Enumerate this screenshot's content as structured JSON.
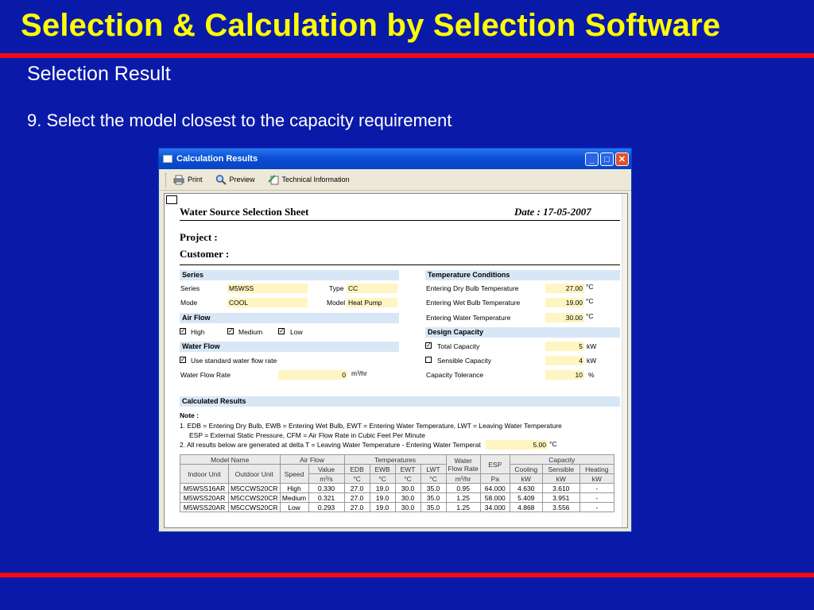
{
  "slide": {
    "title": "Selection & Calculation by Selection Software",
    "subtitle": "Selection Result",
    "step": "9. Select the model closest to the capacity requirement",
    "accent_red": "#F50A14",
    "title_yellow": "#FFFF00",
    "background": "#0A1AA8"
  },
  "window": {
    "title": "Calculation Results",
    "toolbar": {
      "print": "Print",
      "preview": "Preview",
      "tech_info": "Technical Information"
    },
    "controls": {
      "minimize": "_",
      "maximize": "□",
      "close": "✕"
    }
  },
  "sheet": {
    "title": "Water Source Selection Sheet",
    "date": "Date :  17-05-2007",
    "project_label": "Project :",
    "customer_label": "Customer :",
    "series": {
      "header": "Series",
      "series_label": "Series",
      "series_value": "M5WSS",
      "type_label": "Type",
      "type_value": "CC",
      "mode_label": "Mode",
      "mode_value": "COOL",
      "model_label": "Model",
      "model_value": "Heat Pump"
    },
    "air_flow": {
      "header": "Air Flow",
      "high": "High",
      "medium": "Medium",
      "low": "Low"
    },
    "water_flow": {
      "header": "Water Flow",
      "use_standard": "Use standard water flow rate",
      "rate_label": "Water Flow Rate",
      "rate_value": "0",
      "rate_unit": "m³/hr"
    },
    "temperature": {
      "header": "Temperature Conditions",
      "edb_label": "Entering Dry Bulb Temperature",
      "edb_value": "27.00",
      "edb_unit": "°C",
      "ewb_label": "Entering Wet Bulb Temperature",
      "ewb_value": "19.00",
      "ewb_unit": "°C",
      "ewt_label": "Entering Water Temperature",
      "ewt_value": "30.00",
      "ewt_unit": "°C"
    },
    "design": {
      "header": "Design Capacity",
      "total_label": "Total Capacity",
      "total_value": "5",
      "total_unit": "kW",
      "sensible_label": "Sensible Capacity",
      "sensible_value": "4",
      "sensible_unit": "kW",
      "tolerance_label": "Capacity Tolerance",
      "tolerance_value": "10",
      "tolerance_unit": "%"
    },
    "calc": {
      "header": "Calculated Results",
      "note_label": "Note :",
      "note1": "1.  EDB = Entering Dry Bulb, EWB = Entering Wet Bulb, EWT = Entering Water Temperature, LWT = Leaving Water Temperature",
      "note1b": "ESP = External Static Pressure, CFM = Air Flow Rate in Cubic Feet Per Minute",
      "note2": "2.  All results below are generated at delta T = Leaving Water Temperature - Entering Water Temperat",
      "delta_value": "5.00",
      "delta_unit": "°C"
    },
    "table": {
      "h1": {
        "model_name": "Model Name",
        "air_flow": "Air Flow",
        "temperatures": "Temperatures",
        "water_flow_1": "Water",
        "water_flow_2": "Flow Rate",
        "esp": "ESP",
        "capacity": "Capacity"
      },
      "h2": {
        "indoor": "Indoor Unit",
        "outdoor": "Outdoor Unit",
        "speed": "Speed",
        "value": "Value",
        "edb": "EDB",
        "ewb": "EWB",
        "ewt": "EWT",
        "lwt": "LWT",
        "cooling": "Cooling",
        "sensible": "Sensible",
        "heating": "Heating"
      },
      "h3": {
        "value_unit": "m³/s",
        "edb_unit": "°C",
        "ewb_unit": "°C",
        "ewt_unit": "°C",
        "lwt_unit": "°C",
        "flow_unit": "m³/hr",
        "esp_unit": "Pa",
        "cool_unit": "kW",
        "sens_unit": "kW",
        "heat_unit": "kW"
      },
      "rows": [
        [
          "M5WSS16AR",
          "M5CCWS20CR",
          "High",
          "0.330",
          "27.0",
          "19.0",
          "30.0",
          "35.0",
          "0.95",
          "64.000",
          "4.630",
          "3.610",
          "-"
        ],
        [
          "M5WSS20AR",
          "M5CCWS20CR",
          "Medium",
          "0.321",
          "27.0",
          "19.0",
          "30.0",
          "35.0",
          "1.25",
          "58.000",
          "5.409",
          "3.951",
          "-"
        ],
        [
          "M5WSS20AR",
          "M5CCWS20CR",
          "Low",
          "0.293",
          "27.0",
          "19.0",
          "30.0",
          "35.0",
          "1.25",
          "34.000",
          "4.868",
          "3.556",
          "-"
        ]
      ]
    }
  }
}
